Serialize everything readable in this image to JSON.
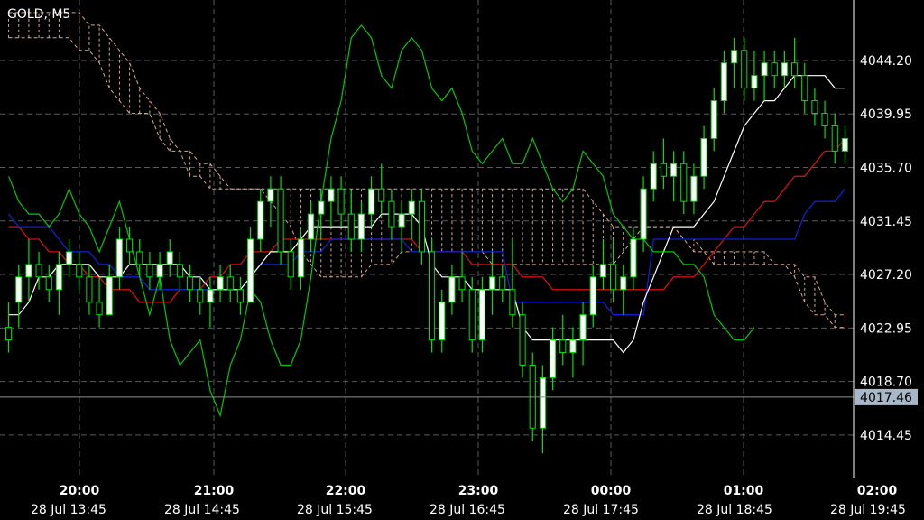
{
  "chart": {
    "title": "GOLD, M5",
    "current_price": "4017.46",
    "colors": {
      "background": "#000000",
      "grid": "#5a5a5a",
      "candle_up_body": "#ffffff",
      "candle_outline": "#00e000",
      "tenkan": "#ffffff",
      "kijun": "#1020d0",
      "chikou": "#00c800",
      "ma": "#d01010",
      "cloud": "#d8a890",
      "price_tag_bg": "#a8b8c8"
    }
  },
  "chart_data": {
    "type": "candlestick",
    "title": "GOLD, M5",
    "y_ticks": [
      "4044.20",
      "4039.95",
      "4035.70",
      "4031.45",
      "4027.20",
      "4022.95",
      "4018.70",
      "4014.45"
    ],
    "session_labels": [
      "20:00",
      "21:00",
      "22:00",
      "23:00",
      "00:00",
      "01:00",
      "02:00"
    ],
    "date_labels": [
      "28 Jul 13:45",
      "28 Jul 14:45",
      "28 Jul 15:45",
      "28 Jul 16:45",
      "28 Jul 17:45",
      "28 Jul 18:45",
      "28 Jul 19:45"
    ],
    "ylim": [
      4011.0,
      4049.0
    ],
    "current_price": 4017.46,
    "candles": [
      [
        4023,
        4025,
        4021,
        4022
      ],
      [
        4025,
        4028,
        4023,
        4027
      ],
      [
        4027,
        4030,
        4025,
        4028
      ],
      [
        4028,
        4029,
        4026,
        4027
      ],
      [
        4027,
        4028,
        4025,
        4026
      ],
      [
        4026,
        4029,
        4024,
        4028
      ],
      [
        4028,
        4030,
        4027,
        4029
      ],
      [
        4028,
        4029,
        4026,
        4027
      ],
      [
        4027,
        4028,
        4024,
        4025
      ],
      [
        4025,
        4027,
        4023,
        4024
      ],
      [
        4024,
        4028,
        4024,
        4027
      ],
      [
        4027,
        4031,
        4026,
        4030
      ],
      [
        4030,
        4031,
        4028,
        4029
      ],
      [
        4029,
        4030,
        4027,
        4028
      ],
      [
        4028,
        4029,
        4026,
        4027
      ],
      [
        4027,
        4029,
        4026,
        4028
      ],
      [
        4028,
        4030,
        4027,
        4029
      ],
      [
        4028,
        4029,
        4026,
        4027
      ],
      [
        4027,
        4028,
        4025,
        4026
      ],
      [
        4026,
        4027,
        4024,
        4025
      ],
      [
        4025,
        4027,
        4023,
        4026
      ],
      [
        4026,
        4028,
        4025,
        4027
      ],
      [
        4027,
        4028,
        4025,
        4026
      ],
      [
        4026,
        4027,
        4024,
        4025
      ],
      [
        4025,
        4031,
        4025,
        4030
      ],
      [
        4030,
        4034,
        4029,
        4033
      ],
      [
        4033,
        4035,
        4031,
        4034
      ],
      [
        4034,
        4035,
        4028,
        4029
      ],
      [
        4029,
        4030,
        4026,
        4027
      ],
      [
        4027,
        4031,
        4026,
        4030
      ],
      [
        4030,
        4033,
        4029,
        4032
      ],
      [
        4032,
        4034,
        4030,
        4033
      ],
      [
        4033,
        4035,
        4031,
        4034
      ],
      [
        4034,
        4035,
        4031,
        4032
      ],
      [
        4032,
        4034,
        4029,
        4030
      ],
      [
        4030,
        4033,
        4029,
        4032
      ],
      [
        4032,
        4035,
        4031,
        4034
      ],
      [
        4034,
        4036,
        4032,
        4033
      ],
      [
        4033,
        4034,
        4030,
        4031
      ],
      [
        4031,
        4033,
        4029,
        4032
      ],
      [
        4032,
        4034,
        4030,
        4033
      ],
      [
        4033,
        4034,
        4028,
        4029
      ],
      [
        4029,
        4030,
        4021,
        4022
      ],
      [
        4022,
        4026,
        4021,
        4025
      ],
      [
        4025,
        4028,
        4024,
        4027
      ],
      [
        4027,
        4029,
        4025,
        4026
      ],
      [
        4026,
        4027,
        4021,
        4022
      ],
      [
        4022,
        4027,
        4021,
        4026
      ],
      [
        4026,
        4029,
        4024,
        4027
      ],
      [
        4027,
        4028,
        4025,
        4026
      ],
      [
        4026,
        4030,
        4023,
        4024
      ],
      [
        4024,
        4025,
        4019,
        4020
      ],
      [
        4020,
        4021,
        4014,
        4015
      ],
      [
        4015,
        4020,
        4013,
        4019
      ],
      [
        4019,
        4023,
        4018,
        4022
      ],
      [
        4022,
        4024,
        4020,
        4021
      ],
      [
        4021,
        4023,
        4019,
        4022
      ],
      [
        4022,
        4025,
        4020,
        4024
      ],
      [
        4024,
        4028,
        4023,
        4027
      ],
      [
        4027,
        4030,
        4026,
        4028
      ],
      [
        4028,
        4030,
        4025,
        4026
      ],
      [
        4026,
        4028,
        4024,
        4027
      ],
      [
        4027,
        4031,
        4026,
        4030
      ],
      [
        4030,
        4035,
        4029,
        4034
      ],
      [
        4034,
        4037,
        4033,
        4036
      ],
      [
        4036,
        4038,
        4034,
        4035
      ],
      [
        4035,
        4037,
        4033,
        4036
      ],
      [
        4036,
        4037,
        4032,
        4033
      ],
      [
        4033,
        4036,
        4032,
        4035
      ],
      [
        4035,
        4039,
        4034,
        4038
      ],
      [
        4038,
        4042,
        4037,
        4041
      ],
      [
        4041,
        4045,
        4040,
        4044
      ],
      [
        4044,
        4046,
        4042,
        4045
      ],
      [
        4045,
        4046,
        4041,
        4042
      ],
      [
        4042,
        4045,
        4041,
        4043
      ],
      [
        4043,
        4045,
        4041,
        4044
      ],
      [
        4044,
        4045,
        4042,
        4043
      ],
      [
        4043,
        4045,
        4042,
        4044
      ],
      [
        4044,
        4046,
        4042,
        4043
      ],
      [
        4043,
        4044,
        4040,
        4041
      ],
      [
        4041,
        4042,
        4039,
        4040
      ],
      [
        4040,
        4041,
        4038,
        4039
      ],
      [
        4039,
        4040,
        4036,
        4037
      ],
      [
        4037,
        4039,
        4036,
        4038
      ]
    ],
    "tenkan": [
      4024,
      4024,
      4025,
      4027,
      4027,
      4028,
      4028,
      4028,
      4028,
      4027,
      4027,
      4027,
      4028,
      4028,
      4028,
      4028,
      4028,
      4028,
      4027,
      4027,
      4026,
      4026,
      4026,
      4026,
      4027,
      4028,
      4029,
      4029,
      4029,
      4030,
      4031,
      4031,
      4031,
      4031,
      4031,
      4031,
      4031,
      4032,
      4032,
      4032,
      4032,
      4031,
      4028,
      4027,
      4027,
      4027,
      4026,
      4026,
      4026,
      4026,
      4026,
      4023,
      4022,
      4022,
      4022,
      4022,
      4022,
      4022,
      4022,
      4022,
      4022,
      4021,
      4022,
      4025,
      4027,
      4029,
      4031,
      4031,
      4031,
      4032,
      4033,
      4035,
      4037,
      4039,
      4040,
      4041,
      4041,
      4042,
      4043,
      4043,
      4043,
      4043,
      4042,
      4042
    ],
    "kijun": [
      4032,
      4031,
      4031,
      4031,
      4031,
      4030,
      4029,
      4029,
      4029,
      4028,
      4028,
      4027,
      4027,
      4027,
      4026,
      4026,
      4026,
      4026,
      4026,
      4026,
      4026,
      4026,
      4026,
      4026,
      4027,
      4028,
      4028,
      4028,
      4028,
      4029,
      4029,
      4029,
      4030,
      4030,
      4030,
      4030,
      4030,
      4030,
      4030,
      4030,
      4029,
      4029,
      4029,
      4029,
      4029,
      4029,
      4029,
      4029,
      4029,
      4029,
      4025,
      4025,
      4025,
      4025,
      4025,
      4025,
      4025,
      4025,
      4025,
      4025,
      4024,
      4024,
      4024,
      4024,
      4030,
      4030,
      4030,
      4030,
      4030,
      4030,
      4030,
      4030,
      4030,
      4030,
      4030,
      4030,
      4030,
      4030,
      4030,
      4032,
      4033,
      4033,
      4033,
      4034
    ],
    "ma": [
      4031,
      4031,
      4030,
      4030,
      4029,
      4029,
      4028,
      4028,
      4027,
      4027,
      4026,
      4026,
      4026,
      4025,
      4025,
      4025,
      4025,
      4026,
      4026,
      4026,
      4027,
      4027,
      4028,
      4028,
      4029,
      4029,
      4029,
      4030,
      4030,
      4030,
      4030,
      4030,
      4030,
      4030,
      4030,
      4030,
      4030,
      4030,
      4030,
      4030,
      4030,
      4029,
      4029,
      4029,
      4029,
      4029,
      4028,
      4028,
      4028,
      4028,
      4028,
      4027,
      4027,
      4027,
      4026,
      4026,
      4026,
      4026,
      4026,
      4026,
      4026,
      4026,
      4026,
      4026,
      4026,
      4026,
      4027,
      4027,
      4027,
      4028,
      4029,
      4030,
      4031,
      4031,
      4032,
      4033,
      4033,
      4034,
      4035,
      4035,
      4036,
      4037,
      4037,
      4038
    ],
    "chikou": [
      4035,
      4033,
      4032,
      4032,
      4031,
      4032,
      4034,
      4032,
      4031,
      4029,
      4031,
      4033,
      4030,
      4027,
      4024,
      4027,
      4022,
      4020,
      4021,
      4022,
      4018,
      4016,
      4020,
      4022,
      4026,
      4025,
      4022,
      4020,
      4020,
      4022,
      4027,
      4033,
      4038,
      4041,
      4046,
      4047,
      4046,
      4043,
      4042,
      4045,
      4046,
      4045,
      4042,
      4041,
      4042,
      4040,
      4037,
      4036,
      4037,
      4038,
      4036,
      4036,
      4038,
      4036,
      4034,
      4033,
      4034,
      4037,
      4036,
      4035,
      4032,
      4031,
      4030,
      4030,
      4029,
      4029,
      4029,
      4028,
      4028,
      4027,
      4024,
      4023,
      4022,
      4022,
      4023
    ],
    "cloud_a": [
      4046,
      4046,
      4046,
      4046,
      4046,
      4046,
      4046,
      4045,
      4045,
      4044,
      4042,
      4041,
      4040,
      4040,
      4040,
      4038,
      4037,
      4037,
      4037,
      4036,
      4036,
      4035,
      4034,
      4034,
      4034,
      4034,
      4034,
      4034,
      4034,
      4034,
      4034,
      4034,
      4034,
      4034,
      4034,
      4034,
      4034,
      4034,
      4034,
      4034,
      4034,
      4034,
      4034,
      4034,
      4034,
      4034,
      4034,
      4034,
      4034,
      4034,
      4034,
      4034,
      4034,
      4034,
      4034,
      4034,
      4034,
      4034,
      4033,
      4032,
      4031,
      4031,
      4031,
      4031,
      4031,
      4031,
      4031,
      4030,
      4029,
      4029,
      4028,
      4028,
      4028,
      4028,
      4028,
      4028,
      4028,
      4028,
      4028,
      4027,
      4027,
      4025,
      4024,
      4024
    ],
    "cloud_b": [
      4048,
      4048,
      4048,
      4048,
      4048,
      4048,
      4048,
      4048,
      4047,
      4047,
      4046,
      4045,
      4044,
      4042,
      4041,
      4040,
      4038,
      4037,
      4035,
      4035,
      4034,
      4034,
      4034,
      4034,
      4034,
      4034,
      4033,
      4032,
      4031,
      4029,
      4028,
      4027,
      4027,
      4027,
      4027,
      4027,
      4028,
      4028,
      4028,
      4029,
      4029,
      4029,
      4029,
      4029,
      4029,
      4029,
      4029,
      4029,
      4028,
      4028,
      4028,
      4028,
      4028,
      4028,
      4028,
      4028,
      4028,
      4028,
      4028,
      4028,
      4028,
      4029,
      4030,
      4031,
      4031,
      4031,
      4031,
      4030,
      4030,
      4029,
      4029,
      4029,
      4029,
      4029,
      4029,
      4029,
      4028,
      4028,
      4027,
      4025,
      4024,
      4024,
      4023,
      4023
    ]
  }
}
